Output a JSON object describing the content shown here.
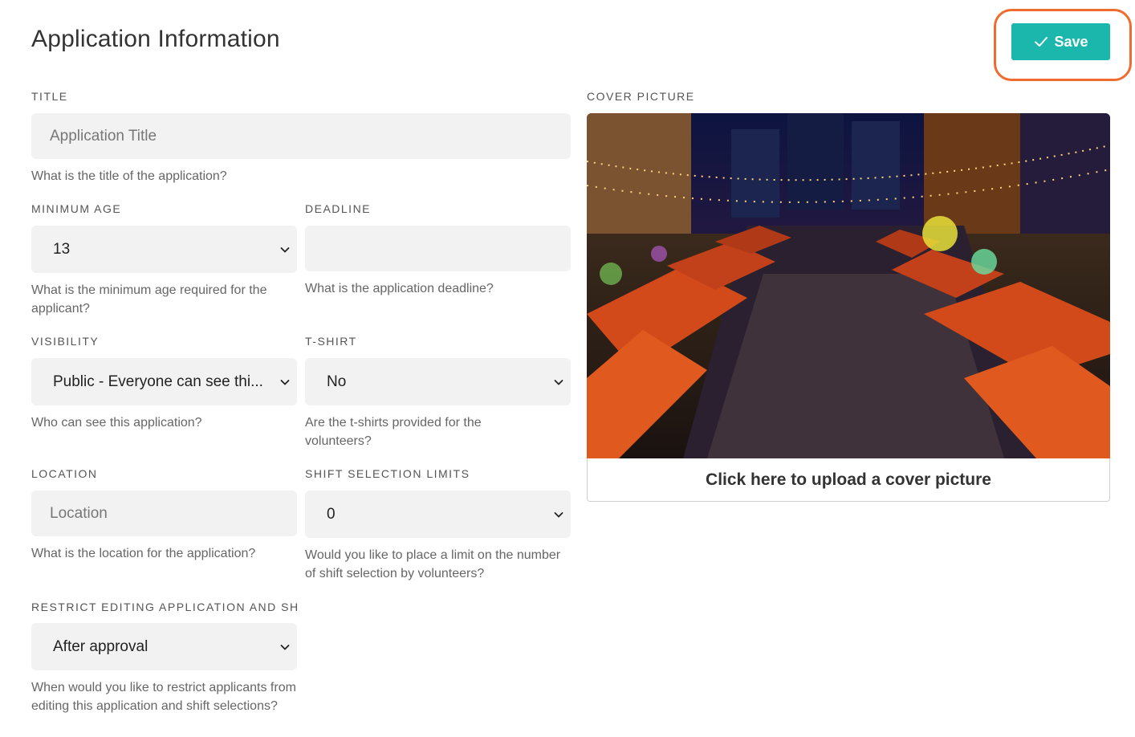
{
  "page": {
    "title": "Application Information"
  },
  "toolbar": {
    "save_label": "Save",
    "accent_color": "#1bb7ad",
    "highlight_color": "#f26b2e"
  },
  "form": {
    "title": {
      "label": "TITLE",
      "placeholder": "Application Title",
      "help": "What is the title of the application?"
    },
    "minimum_age": {
      "label": "MINIMUM AGE",
      "value": "13",
      "help": "What is the minimum age required for the applicant?"
    },
    "deadline": {
      "label": "DEADLINE",
      "value": "",
      "help": "What is the application deadline?"
    },
    "visibility": {
      "label": "VISIBILITY",
      "value": "Public - Everyone can see thi...",
      "help": "Who can see this application?"
    },
    "tshirt": {
      "label": "T-SHIRT",
      "value": "No",
      "help": "Are the t-shirts provided for the volunteers?"
    },
    "location": {
      "label": "LOCATION",
      "placeholder": "Location",
      "help": "What is the location for the application?"
    },
    "shift_limits": {
      "label": "SHIFT SELECTION LIMITS",
      "value": "0",
      "help": "Would you like to place a limit on the number of shift selection by volunteers?"
    },
    "restrict_editing": {
      "label": "RESTRICT EDITING APPLICATION AND SHI...",
      "value": "After approval",
      "help": "When would you like to restrict applicants from editing this application and shift selections?"
    }
  },
  "cover": {
    "label": "COVER PICTURE",
    "upload_label": "Click here to upload a cover picture"
  }
}
